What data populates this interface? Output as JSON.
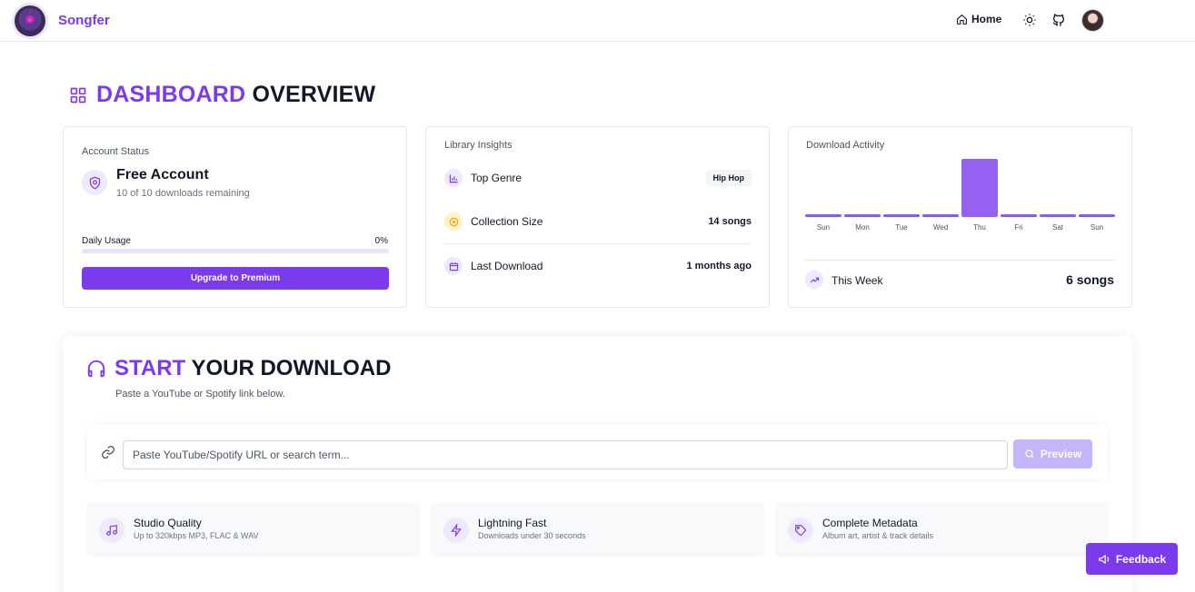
{
  "nav": {
    "brand": "Songfer",
    "home_label": "Home"
  },
  "dashboard": {
    "title_accent": "DASHBOARD",
    "title_rest": "OVERVIEW"
  },
  "account": {
    "label": "Account Status",
    "title": "Free Account",
    "subtitle": "10 of 10 downloads remaining",
    "usage_label": "Daily Usage",
    "usage_value": "0%",
    "usage_fraction": 0,
    "upgrade_label": "Upgrade to Premium"
  },
  "library": {
    "label": "Library Insights",
    "rows": [
      {
        "label": "Top Genre",
        "value": "Hip Hop"
      },
      {
        "label": "Collection Size",
        "value": "14 songs"
      },
      {
        "label": "Last Download",
        "value": "1 months ago"
      }
    ]
  },
  "activity": {
    "label": "Download Activity",
    "week_label": "This Week",
    "week_value": "6 songs"
  },
  "chart_data": {
    "type": "bar",
    "categories": [
      "Sun",
      "Mon",
      "Tue",
      "Wed",
      "Thu",
      "Fri",
      "Sat",
      "Sun"
    ],
    "values": [
      0,
      0,
      0,
      0,
      6,
      0,
      0,
      0
    ],
    "title": "Download Activity"
  },
  "download": {
    "title_accent": "START",
    "title_rest": "YOUR DOWNLOAD",
    "subtitle": "Paste a YouTube or Spotify link below.",
    "input_placeholder": "Paste YouTube/Spotify URL or search term...",
    "preview_label": "Preview",
    "features": [
      {
        "title": "Studio Quality",
        "subtitle": "Up to 320kbps MP3, FLAC & WAV",
        "icon": "music-note-icon"
      },
      {
        "title": "Lightning Fast",
        "subtitle": "Downloads under 30 seconds",
        "icon": "lightning-icon"
      },
      {
        "title": "Complete Metadata",
        "subtitle": "Album art, artist & track details",
        "icon": "tag-icon"
      }
    ]
  },
  "feedback": {
    "label": "Feedback"
  },
  "colors": {
    "accent": "#7c3aed",
    "accent_light": "#ede9fe",
    "preview_disabled": "#c4b5fd"
  }
}
